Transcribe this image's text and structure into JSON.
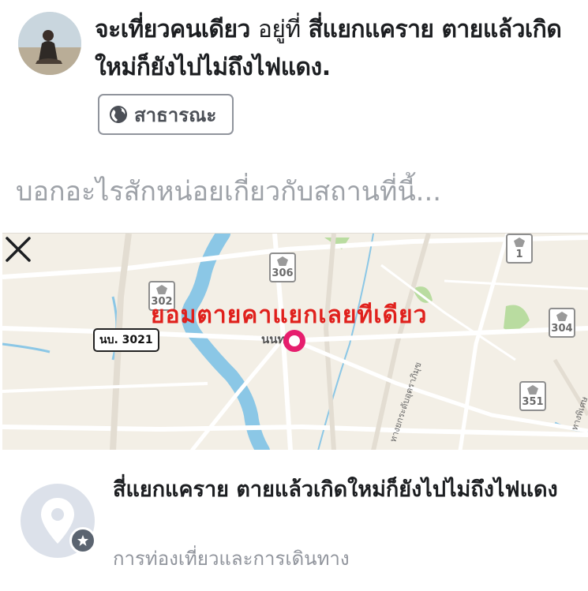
{
  "post": {
    "prefix": "จะเที่ยวคนเดียว",
    "connector": "อยู่ที่",
    "location_text": "สี่แยกแคราย ตายแล้วเกิดใหม่ก็ยังไปไม่ถึงไฟแดง."
  },
  "audience": {
    "label": "สาธารณะ",
    "icon": "globe-icon"
  },
  "composer": {
    "placeholder": "บอกอะไรสักหน่อยเกี่ยวกับสถานที่นี้..."
  },
  "map": {
    "caption": "ยอมตายคาแยกเลยทีเดียว",
    "close_icon": "close-icon",
    "place_label": "นนทบุรี",
    "road_label": "นบ. 3021",
    "route_shields": [
      "306",
      "302",
      "1",
      "304",
      "351"
    ],
    "side_road_labels": [
      "ทางยกระดับอุตราภิมุข",
      "ทางพิเศษ"
    ],
    "pin_color": "#e61e6e"
  },
  "place": {
    "title": "สี่แยกแคราย ตายแล้วเกิดใหม่ก็ยังไปไม่ถึงไฟแดง",
    "category": "การท่องเที่ยวและการเดินทาง",
    "icon": "location-pin-icon",
    "badge_icon": "star-badge-icon"
  }
}
